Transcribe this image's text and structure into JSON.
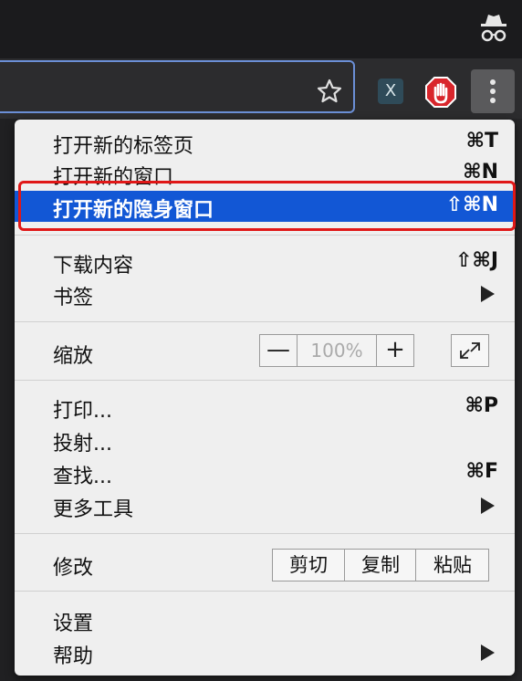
{
  "browser": {
    "incognito_icon": "incognito-icon",
    "star_icon": "bookmark-star-icon",
    "extension_1_label": "X",
    "extension_2_icon": "adblock-hand-icon",
    "menu_icon": "three-dots-vertical-icon"
  },
  "menu": {
    "items": [
      {
        "label": "打开新的标签页",
        "shortcut": "⌘T"
      },
      {
        "label": "打开新的窗口",
        "shortcut": "⌘N"
      },
      {
        "label": "打开新的隐身窗口",
        "shortcut": "⇧⌘N"
      },
      {
        "label": "下载内容",
        "shortcut": "⇧⌘J"
      },
      {
        "label": "书签",
        "shortcut": ""
      },
      {
        "label": "缩放",
        "shortcut": ""
      },
      {
        "label": "打印...",
        "shortcut": "⌘P"
      },
      {
        "label": "投射...",
        "shortcut": ""
      },
      {
        "label": "查找...",
        "shortcut": "⌘F"
      },
      {
        "label": "更多工具",
        "shortcut": ""
      },
      {
        "label": "修改",
        "shortcut": ""
      },
      {
        "label": "设置",
        "shortcut": ""
      },
      {
        "label": "帮助",
        "shortcut": ""
      }
    ],
    "zoom": {
      "minus": "—",
      "value": "100%",
      "plus": "+"
    },
    "edit": {
      "cut": "剪切",
      "copy": "复制",
      "paste": "粘贴"
    }
  },
  "colors": {
    "highlight": "#1257d5",
    "annotation": "#e01818"
  }
}
